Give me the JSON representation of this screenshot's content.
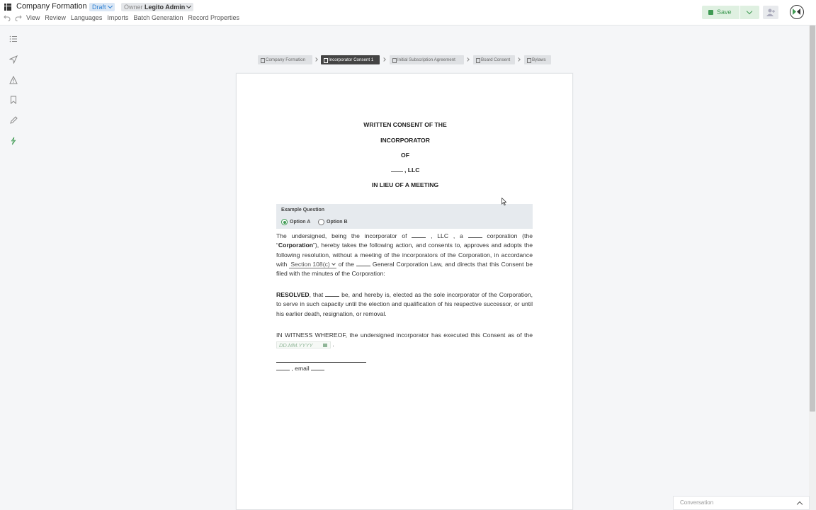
{
  "header": {
    "app_title": "Company Formation",
    "status_badge": "Draft",
    "owner_label": "Owner",
    "owner_name": "Legito Admin",
    "save_label": "Save"
  },
  "menu": [
    "View",
    "Review",
    "Languages",
    "Imports",
    "Batch Generation",
    "Record Properties"
  ],
  "rail_icons": [
    "list-icon",
    "send-icon",
    "warning-icon",
    "bookmark-icon",
    "pen-icon",
    "lightning-icon"
  ],
  "breadcrumb": [
    {
      "label": "Company Formation",
      "active": false
    },
    {
      "label": "Incorporator Consent 1",
      "active": true
    },
    {
      "label": "Initial Subscription Agreement",
      "active": false
    },
    {
      "label": "Board Consent",
      "active": false
    },
    {
      "label": "Bylaws",
      "active": false
    }
  ],
  "document": {
    "title_lines": [
      "WRITTEN CONSENT OF THE",
      "INCORPORATOR",
      "OF",
      ", LLC",
      "IN LIEU OF A MEETING"
    ],
    "question": {
      "label": "Example Question",
      "options": [
        "Option A",
        "Option B"
      ],
      "selected": "Option A"
    },
    "p1": {
      "t1": "The undersigned, being the  incorporator of",
      "t2": ", LLC , a",
      "t3": "corporation (the “",
      "bold": "Corporation",
      "t4": "”), hereby takes the following action, and consents to, approves and adopts the following resolution, without a meeting of the incorporators of the Corporation, in accordance with",
      "select": "Section 108(c)",
      "t5": "of the",
      "t6": "General Corporation Law, and directs that this Consent be filed with the minutes of the Corporation:"
    },
    "p2": {
      "bold": "RESOLVED",
      "t1": ", that",
      "t2": "be, and hereby is, elected as the sole incorporator of the Corporation, to serve in such capacity until the election and qualification of his respective successor, or until his earlier death, resignation, or removal."
    },
    "p3": {
      "t1": "IN WITNESS WHEREOF, the undersigned incorporator has executed this Consent as of the",
      "date_placeholder": "DD.MM.YYYY",
      "t2": "."
    },
    "sig": {
      "t1": ", email"
    }
  },
  "conversation": {
    "label": "Conversation"
  },
  "colors": {
    "accent_green": "#3f9a53",
    "badge_blue": "#2f80d1"
  }
}
